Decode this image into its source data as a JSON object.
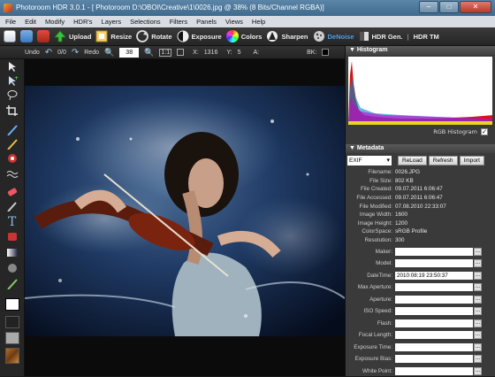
{
  "window": {
    "title": "Photoroom HDR 3.0.1 - [  Photoroom  D:\\OBOI\\Creative\\1\\0026.jpg @ 38% (8 Bits/Channel RGBA)]",
    "min": "–",
    "max": "□",
    "close": "✕"
  },
  "menu": [
    "File",
    "Edit",
    "Modify",
    "HDR's",
    "Layers",
    "Selections",
    "Filters",
    "Panels",
    "Views",
    "Help"
  ],
  "toolbar": {
    "upload": "Upload",
    "resize": "Resize",
    "rotate": "Rotate",
    "exposure": "Exposure",
    "colors": "Colors",
    "sharpen": "Sharpen",
    "denoise": "DeNoise",
    "hdrgen": "HDR Gen.",
    "hdrtm": "HDR TM",
    "denoise_color": "#4a9fe8"
  },
  "toolbar2": {
    "undo": "Undo",
    "history": "0/0",
    "redo": "Redo",
    "zoom": "38",
    "one_to_one": "1:1",
    "x_label": "X:",
    "x_value": "1316",
    "y_label": "Y:",
    "y_value": "5",
    "a_label": "A:",
    "bk_label": "BK:"
  },
  "histogram": {
    "title": "Histogram",
    "caption": "RGB Histogram",
    "checked": "✓"
  },
  "metadata": {
    "title": "Metadata",
    "type": "EXIF",
    "reload": "ReLoad",
    "refresh": "Refresh",
    "import": "Import",
    "info": [
      {
        "label": "Filename:",
        "value": "0026.JPG"
      },
      {
        "label": "File Size:",
        "value": "802 KB"
      },
      {
        "label": "File Created:",
        "value": "09.07.2011 6:06:47"
      },
      {
        "label": "File Accessed:",
        "value": "09.07.2011 6:06:47"
      },
      {
        "label": "File Modified:",
        "value": "07.08.2010 22:33:07"
      },
      {
        "label": "Image Width:",
        "value": "1600"
      },
      {
        "label": "Image Height:",
        "value": "1200"
      },
      {
        "label": "ColorSpace:",
        "value": "sRGB Profile"
      },
      {
        "label": "Resolution:",
        "value": "300"
      }
    ],
    "fields": [
      {
        "label": "Maker:",
        "value": ""
      },
      {
        "label": "Model:",
        "value": ""
      },
      {
        "label": "DateTime:",
        "value": "2010:08:19 23:50:37"
      },
      {
        "label": "Max Aperture:",
        "value": ""
      },
      {
        "label": "Aperture:",
        "value": ""
      },
      {
        "label": "ISO Speed:",
        "value": ""
      },
      {
        "label": "Flash:",
        "value": ""
      },
      {
        "label": "Focal Length:",
        "value": ""
      },
      {
        "label": "Exposure Time:",
        "value": ""
      },
      {
        "label": "Exposure Bias:",
        "value": ""
      },
      {
        "label": "White Point:",
        "value": ""
      }
    ],
    "dots_label": "..."
  }
}
